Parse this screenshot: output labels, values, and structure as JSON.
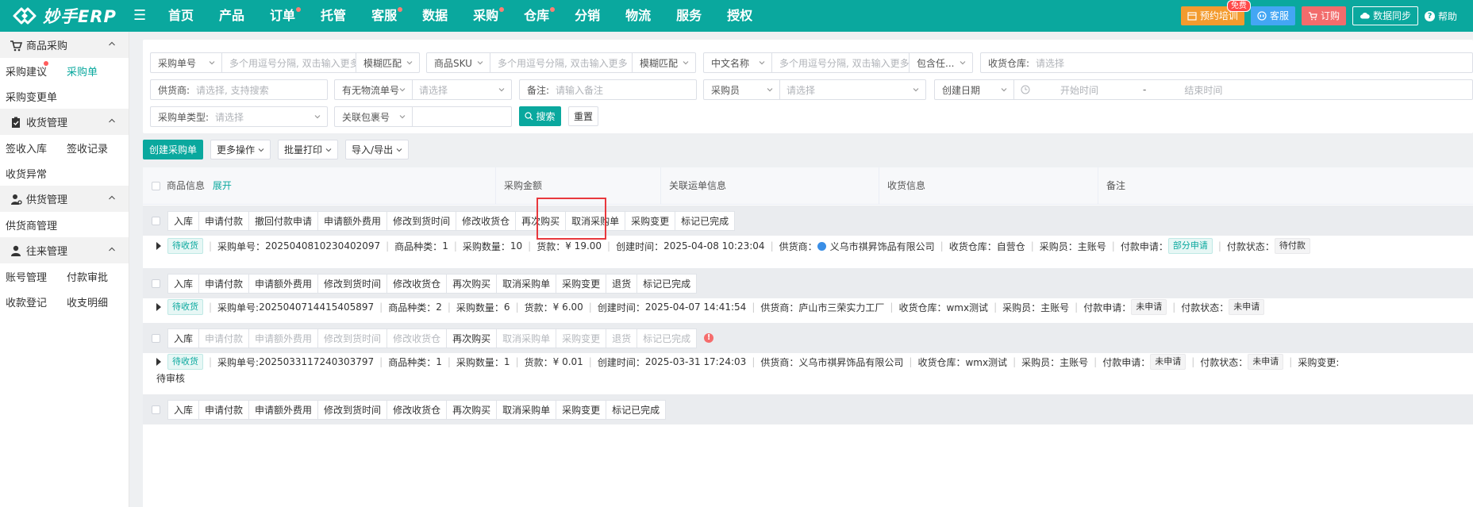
{
  "header": {
    "logo": "妙手ERP",
    "nav": [
      {
        "label": "首页",
        "dot": false
      },
      {
        "label": "产品",
        "dot": false
      },
      {
        "label": "订单",
        "dot": true
      },
      {
        "label": "托管",
        "dot": false
      },
      {
        "label": "客服",
        "dot": true
      },
      {
        "label": "数据",
        "dot": false
      },
      {
        "label": "采购",
        "dot": true
      },
      {
        "label": "仓库",
        "dot": true
      },
      {
        "label": "分销",
        "dot": false
      },
      {
        "label": "物流",
        "dot": false
      },
      {
        "label": "服务",
        "dot": false
      },
      {
        "label": "授权",
        "dot": false
      }
    ],
    "tools": {
      "training": "预约培训",
      "training_badge": "免费",
      "service": "客服",
      "order": "订购",
      "sync": "数据同步",
      "help": "帮助"
    }
  },
  "sidebar": {
    "groups": [
      {
        "label": "商品采购",
        "icon": "cart-icon",
        "rows": [
          [
            "采购建议",
            "采购单"
          ],
          [
            "采购变更单"
          ]
        ]
      },
      {
        "label": "收货管理",
        "icon": "clipboard-icon",
        "rows": [
          [
            "签收入库",
            "签收记录"
          ],
          [
            "收货异常"
          ]
        ]
      },
      {
        "label": "供货管理",
        "icon": "supplier-icon",
        "rows": [
          [
            "供货商管理"
          ]
        ]
      },
      {
        "label": "往来管理",
        "icon": "user-icon",
        "rows": [
          [
            "账号管理",
            "付款审批"
          ],
          [
            "收款登记",
            "收支明细"
          ]
        ]
      }
    ],
    "active": "采购单"
  },
  "filters": {
    "po_no_sel": "采购单号",
    "po_no_ph": "多个用逗号分隔, 双击输入更多",
    "po_match": "模糊匹配",
    "sku_sel": "商品SKU",
    "sku_ph": "多个用逗号分隔, 双击输入更多",
    "sku_match": "模糊匹配",
    "cn_sel": "中文名称",
    "cn_ph": "多个用逗号分隔, 双击输入更多",
    "cn_match": "包含任...",
    "warehouse_label": "收货仓库:",
    "warehouse_ph": "请选择",
    "supplier_label": "供货商:",
    "supplier_ph": "请选择, 支持搜索",
    "logistics_sel": "有无物流单号",
    "logistics_ph": "请选择",
    "remark_label": "备注:",
    "remark_ph": "请输入备注",
    "buyer_sel": "采购员",
    "buyer_ph": "请选择",
    "date_sel": "创建日期",
    "date_start": "开始时间",
    "date_dash": "-",
    "date_end": "结束时间",
    "type_label": "采购单类型:",
    "type_ph": "请选择",
    "pkg_sel": "关联包裹号",
    "search": "搜索",
    "reset": "重置"
  },
  "toolbar": {
    "create": "创建采购单",
    "more": "更多操作",
    "print": "批量打印",
    "import_export": "导入/导出"
  },
  "table": {
    "headers": {
      "goods": "商品信息",
      "expand": "展开",
      "amount": "采购金额",
      "waybill": "关联运单信息",
      "receipt": "收货信息",
      "remark": "备注"
    },
    "orders": [
      {
        "buttons": [
          {
            "label": "入库",
            "disabled": false
          },
          {
            "label": "申请付款",
            "disabled": false
          },
          {
            "label": "撤回付款申请",
            "disabled": false
          },
          {
            "label": "申请额外费用",
            "disabled": false
          },
          {
            "label": "修改到货时间",
            "disabled": false
          },
          {
            "label": "修改收货仓",
            "disabled": false
          },
          {
            "label": "再次购买",
            "disabled": false
          },
          {
            "label": "取消采购单",
            "disabled": false
          },
          {
            "label": "采购变更",
            "disabled": false
          },
          {
            "label": "标记已完成",
            "disabled": false
          }
        ],
        "status": "待收货",
        "po_label": "采购单号：",
        "po_no": "2025040810230402097",
        "kinds_label": "商品种类：",
        "kinds": "1",
        "qty_label": "采购数量：",
        "qty": "10",
        "payment_label": "货款：",
        "payment": "¥ 19.00",
        "created_label": "创建时间：",
        "created": "2025-04-08 10:23:04",
        "supplier_label": "供货商：",
        "supplier": "义乌市祺昇饰品有限公司",
        "warehouse_label": "收货仓库：",
        "warehouse": "自营仓",
        "buyer_label": "采购员：",
        "buyer": "主账号",
        "pay_req_label": "付款申请：",
        "pay_req": "部分申请",
        "pay_status_label": "付款状态：",
        "pay_status": "待付款"
      },
      {
        "buttons": [
          {
            "label": "入库",
            "disabled": false
          },
          {
            "label": "申请付款",
            "disabled": false
          },
          {
            "label": "申请额外费用",
            "disabled": false
          },
          {
            "label": "修改到货时间",
            "disabled": false
          },
          {
            "label": "修改收货仓",
            "disabled": false
          },
          {
            "label": "再次购买",
            "disabled": false
          },
          {
            "label": "取消采购单",
            "disabled": false
          },
          {
            "label": "采购变更",
            "disabled": false
          },
          {
            "label": "退货",
            "disabled": false
          },
          {
            "label": "标记已完成",
            "disabled": false
          }
        ],
        "status": "待收货",
        "po_label": "采购单号:",
        "po_no": "2025040714415405897",
        "kinds_label": "商品种类：",
        "kinds": "2",
        "qty_label": "采购数量：",
        "qty": "6",
        "payment_label": "货款：",
        "payment": "¥ 6.00",
        "created_label": "创建时间：",
        "created": "2025-04-07 14:41:54",
        "supplier_label": "供货商：",
        "supplier": "庐山市三荣实力工厂",
        "warehouse_label": "收货仓库：",
        "warehouse": "wmx测试",
        "buyer_label": "采购员：",
        "buyer": "主账号",
        "pay_req_label": "付款申请：",
        "pay_req": "未申请",
        "pay_status_label": "付款状态：",
        "pay_status": "未申请"
      },
      {
        "buttons": [
          {
            "label": "入库",
            "disabled": false
          },
          {
            "label": "申请付款",
            "disabled": true
          },
          {
            "label": "申请额外费用",
            "disabled": true
          },
          {
            "label": "修改到货时间",
            "disabled": true
          },
          {
            "label": "修改收货仓",
            "disabled": true
          },
          {
            "label": "再次购买",
            "disabled": false
          },
          {
            "label": "取消采购单",
            "disabled": true
          },
          {
            "label": "采购变更",
            "disabled": true
          },
          {
            "label": "退货",
            "disabled": true
          },
          {
            "label": "标记已完成",
            "disabled": true
          }
        ],
        "warning": "!",
        "status": "待收货",
        "po_label": "采购单号:",
        "po_no": "2025033117240303797",
        "kinds_label": "商品种类：",
        "kinds": "1",
        "qty_label": "采购数量：",
        "qty": "1",
        "payment_label": "货款：",
        "payment": "¥ 0.01",
        "created_label": "创建时间：",
        "created": "2025-03-31 17:24:03",
        "supplier_label": "供货商：",
        "supplier": "义乌市祺昇饰品有限公司",
        "warehouse_label": "收货仓库：",
        "warehouse": "wmx测试",
        "buyer_label": "采购员：",
        "buyer": "主账号",
        "pay_req_label": "付款申请：",
        "pay_req": "未申请",
        "pay_status_label": "付款状态：",
        "pay_status": "未申请",
        "change_label": "采购变更:",
        "change": "待审核"
      },
      {
        "buttons": [
          {
            "label": "入库",
            "disabled": false
          },
          {
            "label": "申请付款",
            "disabled": false
          },
          {
            "label": "申请额外费用",
            "disabled": false
          },
          {
            "label": "修改到货时间",
            "disabled": false
          },
          {
            "label": "修改收货仓",
            "disabled": false
          },
          {
            "label": "再次购买",
            "disabled": false
          },
          {
            "label": "取消采购单",
            "disabled": false
          },
          {
            "label": "采购变更",
            "disabled": false
          },
          {
            "label": "标记已完成",
            "disabled": false
          }
        ]
      }
    ]
  },
  "colors": {
    "brand": "#0aa89e",
    "highlight": "#e8383d"
  }
}
